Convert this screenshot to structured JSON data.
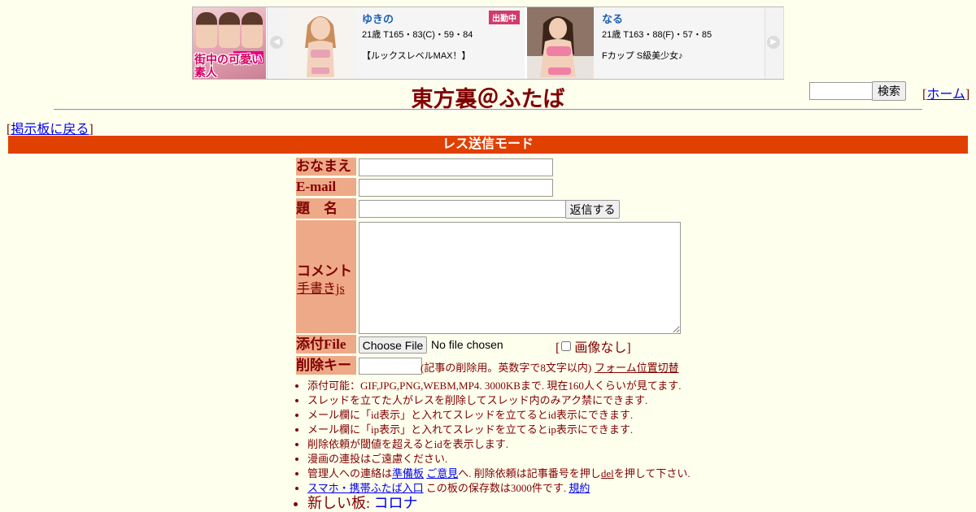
{
  "ad": {
    "logo": {
      "badge": "新宿Lip",
      "caption": "街中の可愛い素人"
    },
    "cards": [
      {
        "name": "ゆきの",
        "stats": "21歳 T165・83(C)・59・84",
        "text": "【ルックスレベルMAX！】",
        "badge": "出勤中"
      },
      {
        "name": "なる",
        "stats": "21歳 T163・88(F)・57・85",
        "text": "Fカップ S級美少女♪"
      }
    ],
    "prev_glyph": "◀",
    "next_glyph": "▶"
  },
  "header": {
    "title": "東方裏＠ふたば",
    "search_button": "検索",
    "home_link": "ホーム"
  },
  "nav": {
    "back_link": "掲示板に戻る"
  },
  "mode_bar": "レス送信モード",
  "form": {
    "name_label": "おなまえ",
    "email_label": "E-mail",
    "subject_label": "題　名",
    "submit_button": "返信する",
    "comment_label": "コメント",
    "tegaki_link": "手書きjs",
    "file_label": "添付File",
    "choose_file_button": "Choose File",
    "no_file_text": "No file chosen",
    "no_image_label": "画像なし",
    "delkey_label": "削除キー",
    "delkey_note": "(記事の削除用。英数字で8文字以内)",
    "form_position_link": "フォーム位置切替"
  },
  "notes": {
    "line1": "添付可能：GIF,JPG,PNG,WEBM,MP4. 3000KBまで. 現在160人くらいが見てます.",
    "line2": "スレッドを立てた人がレスを削除してスレッド内のみアク禁にできます.",
    "line3": "メール欄に「id表示」と入れてスレッドを立てるとid表示にできます.",
    "line4": "メール欄に「ip表示」と入れてスレッドを立てるとip表示にできます.",
    "line5": "削除依頼が閾値を超えるとidを表示します.",
    "line6": "漫画の連投はご遠慮ください.",
    "line7_prefix": "管理人への連絡は",
    "line7_link1": "準備板",
    "line7_link2": "ご意見",
    "line7_mid": "へ. 削除依頼は記事番号を押し",
    "line7_del": "del",
    "line7_suffix": "を押して下さい.",
    "line8_link": "スマホ・携帯ふたば入口",
    "line8_text": "この板の保存数は3000件です.",
    "line8_rules": "規約",
    "line9_prefix": "新しい板:",
    "line9_link": "コロナ"
  }
}
